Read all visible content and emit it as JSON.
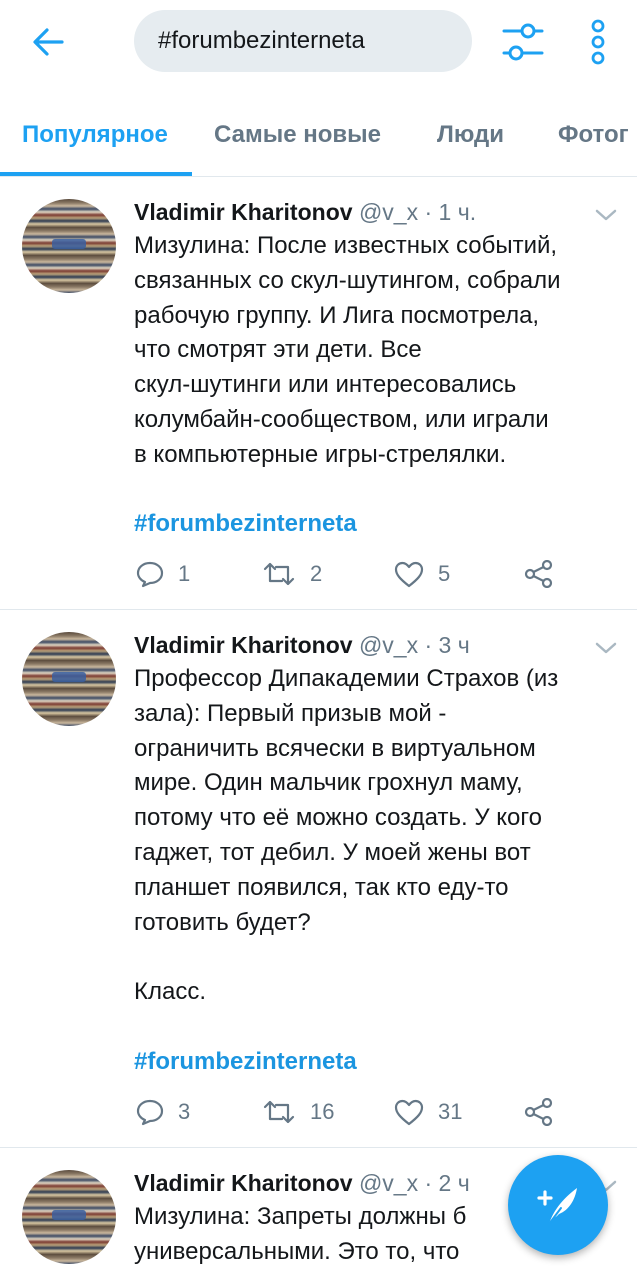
{
  "search": {
    "value": "#forumbezinterneta"
  },
  "tabs": [
    {
      "label": "Популярное"
    },
    {
      "label": "Самые новые"
    },
    {
      "label": "Люди"
    },
    {
      "label": "Фотог"
    }
  ],
  "tweets": [
    {
      "name": "Vladimir Kharitonov",
      "handle": "@v_x",
      "dot": "·",
      "time": "1 ч.",
      "text": "Мизулина: После известных событий,\nсвязанных со скул-шутингом, собрали\nрабочую группу. И Лига посмотрела,\nчто смотрят эти дети. Все\nскул-шутинги или интересовались\nколумбайн-сообществом, или играли\nв компьютерные игры-стрелялки.",
      "hashtag": "#forumbezinterneta",
      "replies": "1",
      "retweets": "2",
      "likes": "5"
    },
    {
      "name": "Vladimir Kharitonov",
      "handle": "@v_x",
      "dot": "·",
      "time": "3 ч",
      "text": "Профессор Дипакадемии Страхов (из\nзала): Первый призыв мой -\nограничить всячески в виртуальном\nмире. Один мальчик грохнул маму,\nпотому что её можно создать. У кого\nгаджет, тот дебил. У моей жены вот\nпланшет появился, так кто еду-то\nготовить будет?\n\nКласс.",
      "hashtag": "#forumbezinterneta",
      "replies": "3",
      "retweets": "16",
      "likes": "31"
    },
    {
      "name": "Vladimir Kharitonov",
      "handle": "@v_x",
      "dot": "·",
      "time": "2 ч",
      "text": "Мизулина: Запреты должны б\nуниверсальными. Это то, что"
    }
  ],
  "icons": {
    "back": "arrow-left-icon",
    "filter": "sliders-icon",
    "more": "more-vertical-icon",
    "reply": "reply-icon",
    "retweet": "retweet-icon",
    "like": "heart-icon",
    "share": "share-icon",
    "compose": "compose-tweet-icon"
  },
  "colors": {
    "accent": "#1da1f2",
    "hashtag": "#1b95e0",
    "muted": "#657786",
    "search_bg": "#e6ecf0"
  }
}
